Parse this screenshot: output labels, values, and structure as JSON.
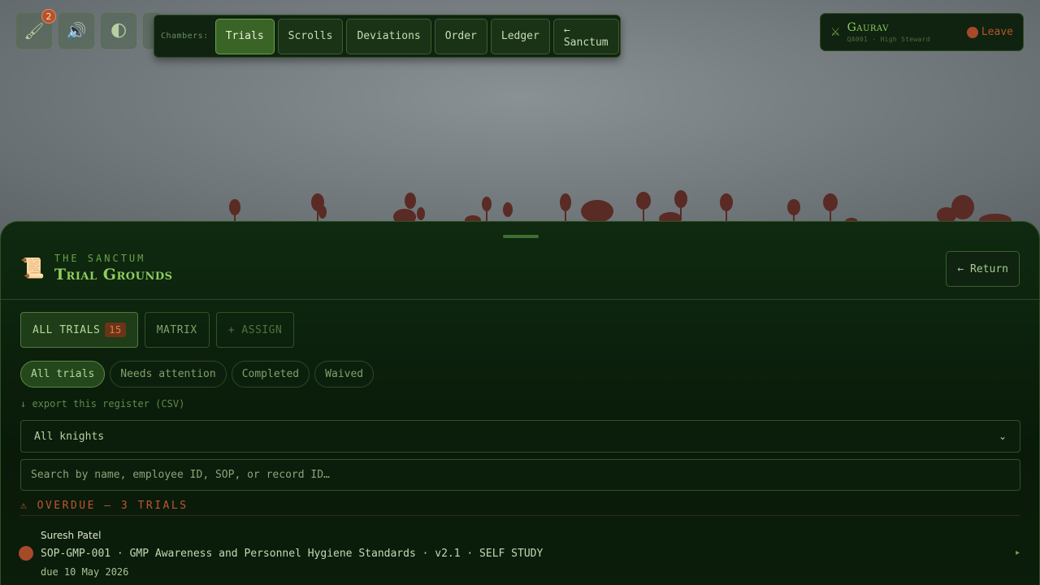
{
  "toolbar": {
    "quill_icon": "quill-icon",
    "notification_count": "2",
    "sound_icon": "speaker-icon",
    "theme_icon": "half-moon-icon"
  },
  "chambers": {
    "label": "Chambers:",
    "items": [
      {
        "label": "Trials",
        "active": true
      },
      {
        "label": "Scrolls",
        "active": false
      },
      {
        "label": "Deviations",
        "active": false
      },
      {
        "label": "Order",
        "active": false
      },
      {
        "label": "Ledger",
        "active": false
      },
      {
        "label": "← Sanctum",
        "active": false
      }
    ]
  },
  "user": {
    "name": "Gaurav",
    "role": "QA001 · High Steward",
    "leave_label": "Leave"
  },
  "panel": {
    "kicker": "THE SANCTUM",
    "title": "Trial Grounds",
    "return_label": "← Return",
    "tabs": {
      "all_label": "ALL TRIALS",
      "all_count": "15",
      "matrix_label": "MATRIX",
      "assign_label": "+ ASSIGN"
    },
    "filters": [
      "All trials",
      "Needs attention",
      "Completed",
      "Waived"
    ],
    "export_label": "↓ export this register (CSV)",
    "knight_select": "All knights",
    "search_placeholder": "Search by name, employee ID, SOP, or record ID…",
    "overdue_label": "⚠ OVERDUE — 3 TRIALS",
    "rows": [
      {
        "name": "Suresh Patel",
        "line": "SOP-GMP-001 · GMP Awareness and Personnel Hygiene Standards · v2.1 · SELF STUDY",
        "due": "due 10 May 2026"
      }
    ]
  },
  "colors": {
    "accent": "#8fcc5e",
    "overdue": "#c0552f",
    "panel_bg": "#0f2a10"
  }
}
